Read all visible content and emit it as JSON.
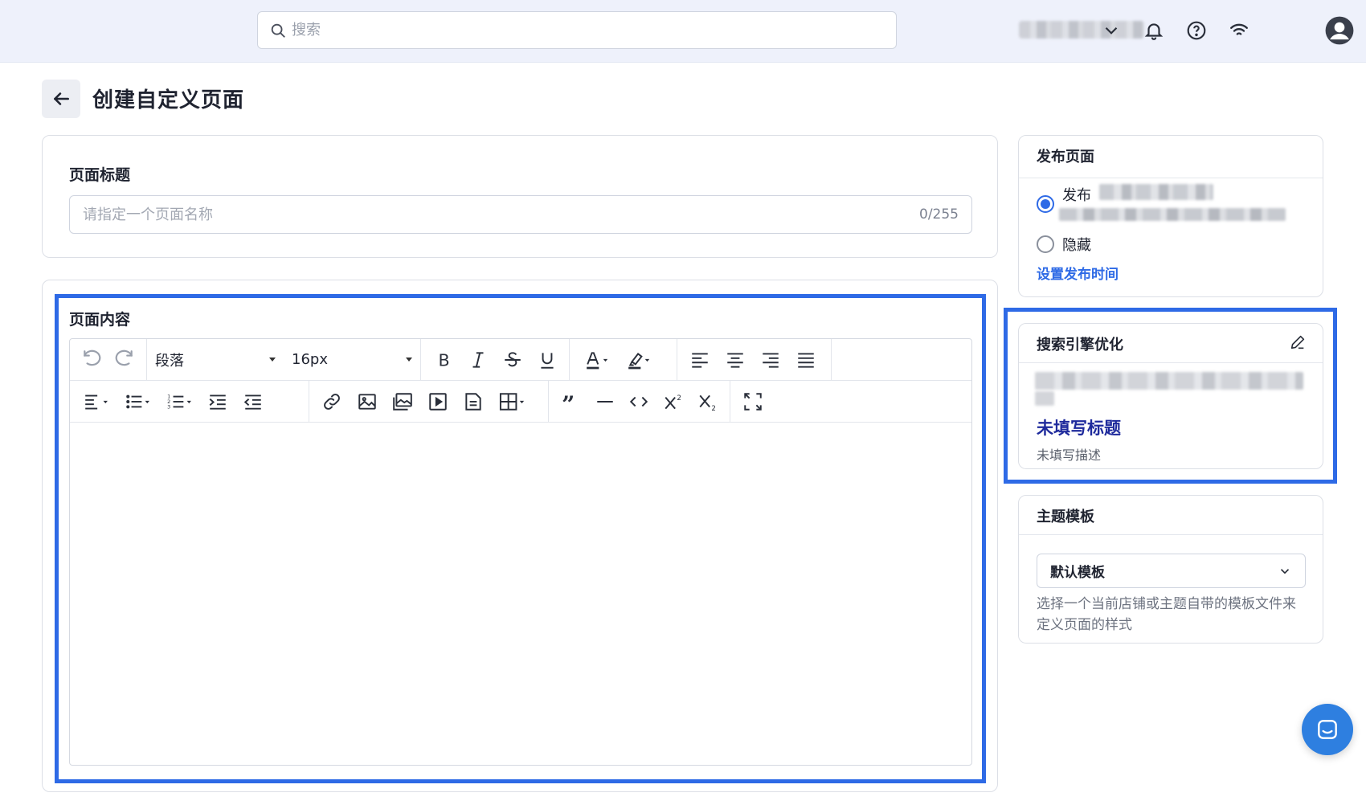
{
  "search": {
    "placeholder": "搜索"
  },
  "header": {
    "account_label": "",
    "icons": [
      "chevron-down-icon",
      "bell-icon",
      "help-icon",
      "wifi-icon",
      "avatar-icon"
    ]
  },
  "page": {
    "title": "创建自定义页面"
  },
  "title_section": {
    "label": "页面标题",
    "placeholder": "请指定一个页面名称",
    "counter": "0/255",
    "value": ""
  },
  "content_section": {
    "label": "页面内容",
    "paragraph_format": "段落",
    "font_size": "16px"
  },
  "publish": {
    "title": "发布页面",
    "publish_label": "发布",
    "hide_label": "隐藏",
    "selected": "发布",
    "schedule_link": "设置发布时间"
  },
  "seo": {
    "title": "搜索引擎优化",
    "preview_title": "未填写标题",
    "preview_desc": "未填写描述"
  },
  "theme": {
    "title": "主题模板",
    "selected": "默认模板",
    "hint": "选择一个当前店铺或主题自带的模板文件来定义页面的样式"
  },
  "colors": {
    "accent": "#2e6ae6",
    "highlight_border": "#2e6ae6",
    "topbar_bg": "#eef1fb",
    "seo_title": "#1e2a9c",
    "chat_button": "#2e7fe0"
  }
}
